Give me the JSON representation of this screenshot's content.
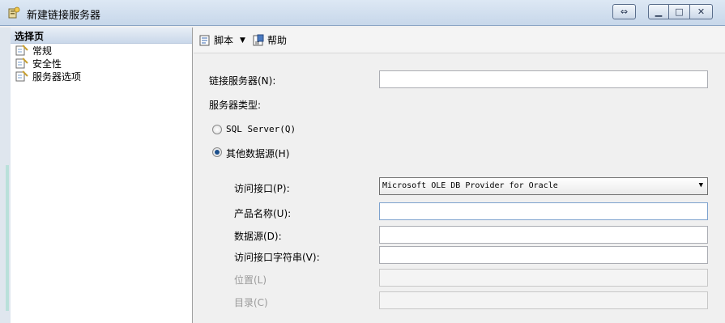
{
  "window": {
    "title": "新建链接服务器"
  },
  "sidebar": {
    "header": "选择页",
    "items": [
      {
        "label": "常规"
      },
      {
        "label": "安全性"
      },
      {
        "label": "服务器选项"
      }
    ]
  },
  "toolbar": {
    "script_label": "脚本",
    "help_label": "帮助"
  },
  "form": {
    "linked_server_label": "链接服务器(N):",
    "linked_server_value": "",
    "server_type_label": "服务器类型:",
    "sql_server_label": "SQL Server(Q)",
    "other_source_label": "其他数据源(H)",
    "provider_label": "访问接口(P):",
    "provider_value": "Microsoft OLE DB Provider for Oracle",
    "product_name_label": "产品名称(U):",
    "product_name_value": "",
    "data_source_label": "数据源(D):",
    "data_source_value": "",
    "provider_string_label": "访问接口字符串(V):",
    "provider_string_value": "",
    "location_label": "位置(L)",
    "catalog_label": "目录(C)"
  },
  "icons": {
    "window": "server-icon",
    "page": "page-icon",
    "script": "script-icon",
    "help": "help-icon"
  }
}
